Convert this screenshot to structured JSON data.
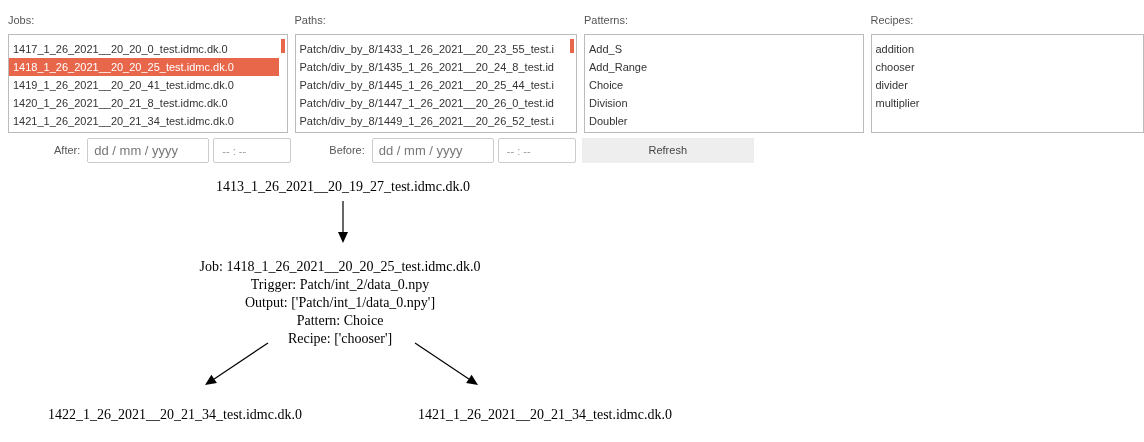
{
  "lists": [
    {
      "label": "Jobs:",
      "items": [
        {
          "text": "1417_1_26_2021__20_20_0_test.idmc.dk.0",
          "selected": false
        },
        {
          "text": "1418_1_26_2021__20_20_25_test.idmc.dk.0",
          "selected": true
        },
        {
          "text": "1419_1_26_2021__20_20_41_test.idmc.dk.0",
          "selected": false
        },
        {
          "text": "1420_1_26_2021__20_21_8_test.idmc.dk.0",
          "selected": false
        },
        {
          "text": "1421_1_26_2021__20_21_34_test.idmc.dk.0",
          "selected": false
        }
      ]
    },
    {
      "label": "Paths:",
      "items": [
        {
          "text": "Patch/div_by_8/1433_1_26_2021__20_23_55_test.i",
          "selected": false
        },
        {
          "text": "Patch/div_by_8/1435_1_26_2021__20_24_8_test.id",
          "selected": false
        },
        {
          "text": "Patch/div_by_8/1445_1_26_2021__20_25_44_test.i",
          "selected": false
        },
        {
          "text": "Patch/div_by_8/1447_1_26_2021__20_26_0_test.id",
          "selected": false
        },
        {
          "text": "Patch/div_by_8/1449_1_26_2021__20_26_52_test.i",
          "selected": false
        }
      ]
    },
    {
      "label": "Patterns:",
      "items": [
        {
          "text": "Add_S",
          "selected": false
        },
        {
          "text": "Add_Range",
          "selected": false
        },
        {
          "text": "Choice",
          "selected": false
        },
        {
          "text": "Division",
          "selected": false
        },
        {
          "text": "Doubler",
          "selected": false
        }
      ]
    },
    {
      "label": "Recipes:",
      "items": [
        {
          "text": "addition",
          "selected": false
        },
        {
          "text": "chooser",
          "selected": false
        },
        {
          "text": "divider",
          "selected": false
        },
        {
          "text": "multiplier",
          "selected": false
        }
      ]
    }
  ],
  "filters": [
    {
      "label": "After:",
      "date_placeholder": "dd / mm / yyyy",
      "time_placeholder": "-- : --"
    },
    {
      "label": "Before:",
      "date_placeholder": "dd / mm / yyyy",
      "time_placeholder": "-- : --"
    }
  ],
  "refresh_button": "Refresh",
  "graph": {
    "nodes": [
      {
        "lines": [
          "1413_1_26_2021__20_19_27_test.idmc.dk.0"
        ]
      },
      {
        "lines": [
          "Job: 1418_1_26_2021__20_20_25_test.idmc.dk.0",
          "Trigger: Patch/int_2/data_0.npy",
          "Output: ['Patch/int_1/data_0.npy']",
          "Pattern: Choice",
          "Recipe: ['chooser']"
        ]
      },
      {
        "lines": [
          "1422_1_26_2021__20_21_34_test.idmc.dk.0"
        ]
      },
      {
        "lines": [
          "1421_1_26_2021__20_21_34_test.idmc.dk.0"
        ]
      }
    ]
  }
}
